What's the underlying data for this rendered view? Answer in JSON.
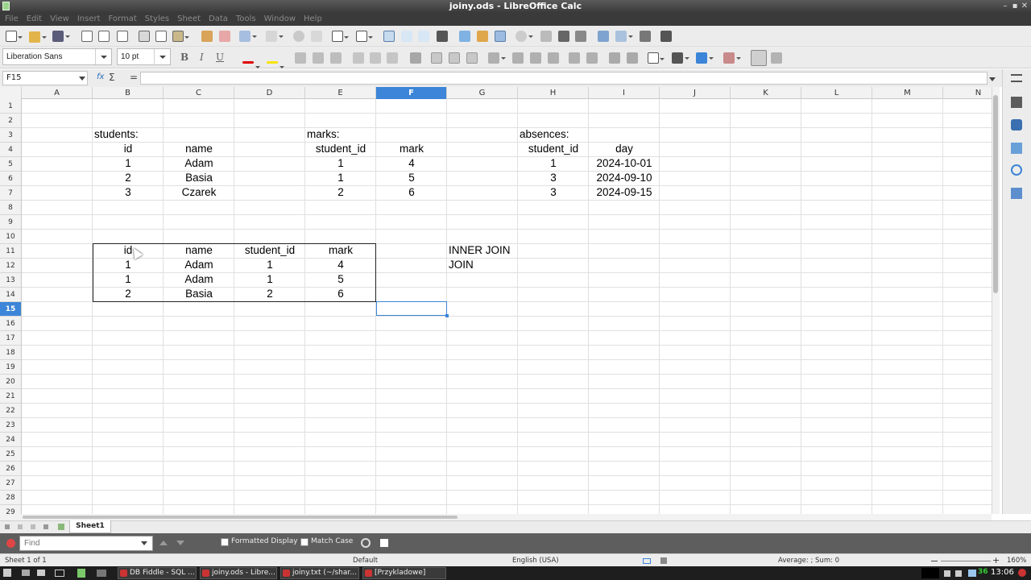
{
  "window": {
    "title": "joiny.ods - LibreOffice Calc",
    "btns": [
      "–",
      "▪",
      "✕"
    ]
  },
  "menu": [
    "File",
    "Edit",
    "View",
    "Insert",
    "Format",
    "Styles",
    "Sheet",
    "Data",
    "Tools",
    "Window",
    "Help"
  ],
  "formatting": {
    "font": "Liberation Sans",
    "size": "10 pt",
    "bold": "B",
    "italic": "I",
    "underline": "U",
    "font_color": "#e00000",
    "highlight_color": "#f5e400"
  },
  "formula_bar": {
    "cell_ref": "F15",
    "fx": "fx",
    "sigma": "Σ",
    "equals": "=",
    "value": ""
  },
  "columns": [
    "A",
    "B",
    "C",
    "D",
    "E",
    "F",
    "G",
    "H",
    "I",
    "J",
    "K",
    "L",
    "M",
    "N"
  ],
  "rows": [
    "1",
    "2",
    "3",
    "4",
    "5",
    "6",
    "7",
    "8",
    "9",
    "10",
    "11",
    "12",
    "13",
    "14",
    "15",
    "16",
    "17",
    "18",
    "19",
    "20",
    "21",
    "22",
    "23",
    "24",
    "25",
    "26",
    "27",
    "28",
    "29"
  ],
  "selected": {
    "column": "F",
    "row": "15"
  },
  "cells": {
    "b3": "students:",
    "e3": "marks:",
    "h3": "absences:",
    "b4": "id",
    "c4": "name",
    "e4": "student_id",
    "f4": "mark",
    "h4": "student_id",
    "i4": "day",
    "b5": "1",
    "c5": "Adam",
    "e5": "1",
    "f5": "4",
    "h5": "1",
    "i5": "2024-10-01",
    "b6": "2",
    "c6": "Basia",
    "e6": "1",
    "f6": "5",
    "h6": "3",
    "i6": "2024-09-10",
    "b7": "3",
    "c7": "Czarek",
    "e7": "2",
    "f7": "6",
    "h7": "3",
    "i7": "2024-09-15",
    "b11": "id",
    "c11": "name",
    "d11": "student_id",
    "e11": "mark",
    "g11": "INNER JOIN",
    "b12": "1",
    "c12": "Adam",
    "d12": "1",
    "e12": "4",
    "g12": "JOIN",
    "b13": "1",
    "c13": "Adam",
    "d13": "1",
    "e13": "5",
    "b14": "2",
    "c14": "Basia",
    "d14": "2",
    "e14": "6"
  },
  "sheet_tab": "Sheet1",
  "find": {
    "placeholder": "Find",
    "formatted_display": "Formatted Display",
    "match_case": "Match Case"
  },
  "status": {
    "sheet": "Sheet 1 of 1",
    "style": "Default",
    "language": "English (USA)",
    "summary": "Average: ; Sum: 0",
    "zoom": "160%"
  },
  "taskbar": {
    "items": [
      "DB Fiddle - SQL ...",
      "joiny.ods - Libre...",
      "joiny.txt (~/shar...",
      "[Przykladowe]"
    ],
    "clock": "13:06",
    "tray_num": "36"
  }
}
